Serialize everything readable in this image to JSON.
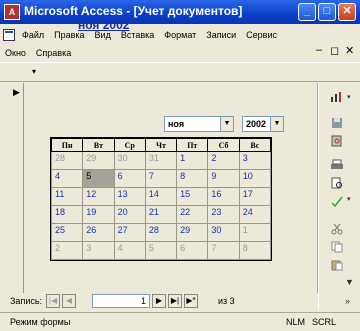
{
  "window": {
    "title": "Microsoft Access - [Учет документов]",
    "min_glyph": "_",
    "max_glyph": "□",
    "close_glyph": "✕"
  },
  "menu": {
    "row1": [
      "Файл",
      "Правка",
      "Вид",
      "Вставка",
      "Формат",
      "Записи",
      "Сервис"
    ],
    "row2": [
      "Окно",
      "Справка"
    ],
    "mdi_min": "–",
    "mdi_max": "◻",
    "mdi_close": "✕"
  },
  "form": {
    "title": "ноя 2002",
    "month_value": "ноя",
    "year_value": "2002"
  },
  "calendar": {
    "weekdays": [
      "Пн",
      "Вт",
      "Ср",
      "Чт",
      "Пт",
      "Сб",
      "Вс"
    ],
    "weeks": [
      [
        {
          "d": "28",
          "o": true
        },
        {
          "d": "29",
          "o": true
        },
        {
          "d": "30",
          "o": true
        },
        {
          "d": "31",
          "o": true
        },
        {
          "d": "1"
        },
        {
          "d": "2"
        },
        {
          "d": "3"
        }
      ],
      [
        {
          "d": "4"
        },
        {
          "d": "5",
          "sel": true
        },
        {
          "d": "6"
        },
        {
          "d": "7"
        },
        {
          "d": "8"
        },
        {
          "d": "9"
        },
        {
          "d": "10"
        }
      ],
      [
        {
          "d": "11"
        },
        {
          "d": "12"
        },
        {
          "d": "13"
        },
        {
          "d": "14"
        },
        {
          "d": "15"
        },
        {
          "d": "16"
        },
        {
          "d": "17"
        }
      ],
      [
        {
          "d": "18"
        },
        {
          "d": "19"
        },
        {
          "d": "20"
        },
        {
          "d": "21"
        },
        {
          "d": "22"
        },
        {
          "d": "23"
        },
        {
          "d": "24"
        }
      ],
      [
        {
          "d": "25"
        },
        {
          "d": "26"
        },
        {
          "d": "27"
        },
        {
          "d": "28"
        },
        {
          "d": "29"
        },
        {
          "d": "30"
        },
        {
          "d": "1",
          "o": true
        }
      ],
      [
        {
          "d": "2",
          "o": true
        },
        {
          "d": "3",
          "o": true
        },
        {
          "d": "4",
          "o": true
        },
        {
          "d": "5",
          "o": true
        },
        {
          "d": "6",
          "o": true
        },
        {
          "d": "7",
          "o": true
        },
        {
          "d": "8",
          "o": true
        }
      ]
    ]
  },
  "navigation": {
    "label": "Запись:",
    "current": "1",
    "of_label": "из 3"
  },
  "status": {
    "mode": "Режим формы",
    "num": "NLM",
    "scrl": "SCRL"
  },
  "colors": {
    "titlebar": "#0a3fc8",
    "day_text": "#1a2eb0",
    "other_month": "#9a9a9a",
    "selected_bg": "#a5a29a"
  }
}
